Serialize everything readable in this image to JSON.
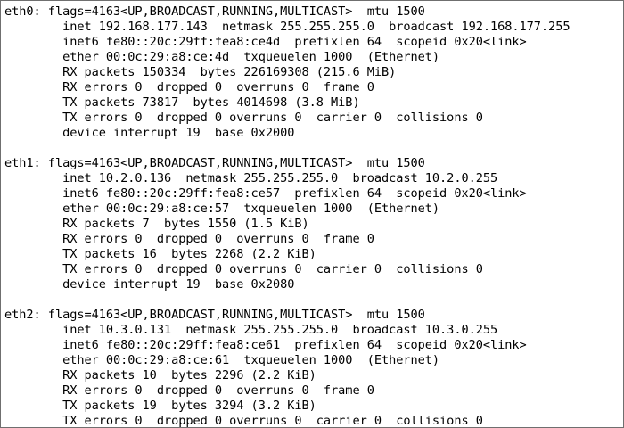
{
  "terminal": {
    "blocks": [
      {
        "lines": [
          "eth0: flags=4163<UP,BROADCAST,RUNNING,MULTICAST>  mtu 1500",
          "        inet 192.168.177.143  netmask 255.255.255.0  broadcast 192.168.177.255",
          "        inet6 fe80::20c:29ff:fea8:ce4d  prefixlen 64  scopeid 0x20<link>",
          "        ether 00:0c:29:a8:ce:4d  txqueuelen 1000  (Ethernet)",
          "        RX packets 150334  bytes 226169308 (215.6 MiB)",
          "        RX errors 0  dropped 0  overruns 0  frame 0",
          "        TX packets 73817  bytes 4014698 (3.8 MiB)",
          "        TX errors 0  dropped 0 overruns 0  carrier 0  collisions 0",
          "        device interrupt 19  base 0x2000"
        ]
      },
      {
        "lines": [
          "eth1: flags=4163<UP,BROADCAST,RUNNING,MULTICAST>  mtu 1500",
          "        inet 10.2.0.136  netmask 255.255.255.0  broadcast 10.2.0.255",
          "        inet6 fe80::20c:29ff:fea8:ce57  prefixlen 64  scopeid 0x20<link>",
          "        ether 00:0c:29:a8:ce:57  txqueuelen 1000  (Ethernet)",
          "        RX packets 7  bytes 1550 (1.5 KiB)",
          "        RX errors 0  dropped 0  overruns 0  frame 0",
          "        TX packets 16  bytes 2268 (2.2 KiB)",
          "        TX errors 0  dropped 0 overruns 0  carrier 0  collisions 0",
          "        device interrupt 19  base 0x2080"
        ]
      },
      {
        "lines": [
          "eth2: flags=4163<UP,BROADCAST,RUNNING,MULTICAST>  mtu 1500",
          "        inet 10.3.0.131  netmask 255.255.255.0  broadcast 10.3.0.255",
          "        inet6 fe80::20c:29ff:fea8:ce61  prefixlen 64  scopeid 0x20<link>",
          "        ether 00:0c:29:a8:ce:61  txqueuelen 1000  (Ethernet)",
          "        RX packets 10  bytes 2296 (2.2 KiB)",
          "        RX errors 0  dropped 0  overruns 0  frame 0",
          "        TX packets 19  bytes 3294 (3.2 KiB)",
          "        TX errors 0  dropped 0 overruns 0  carrier 0  collisions 0"
        ]
      }
    ]
  }
}
